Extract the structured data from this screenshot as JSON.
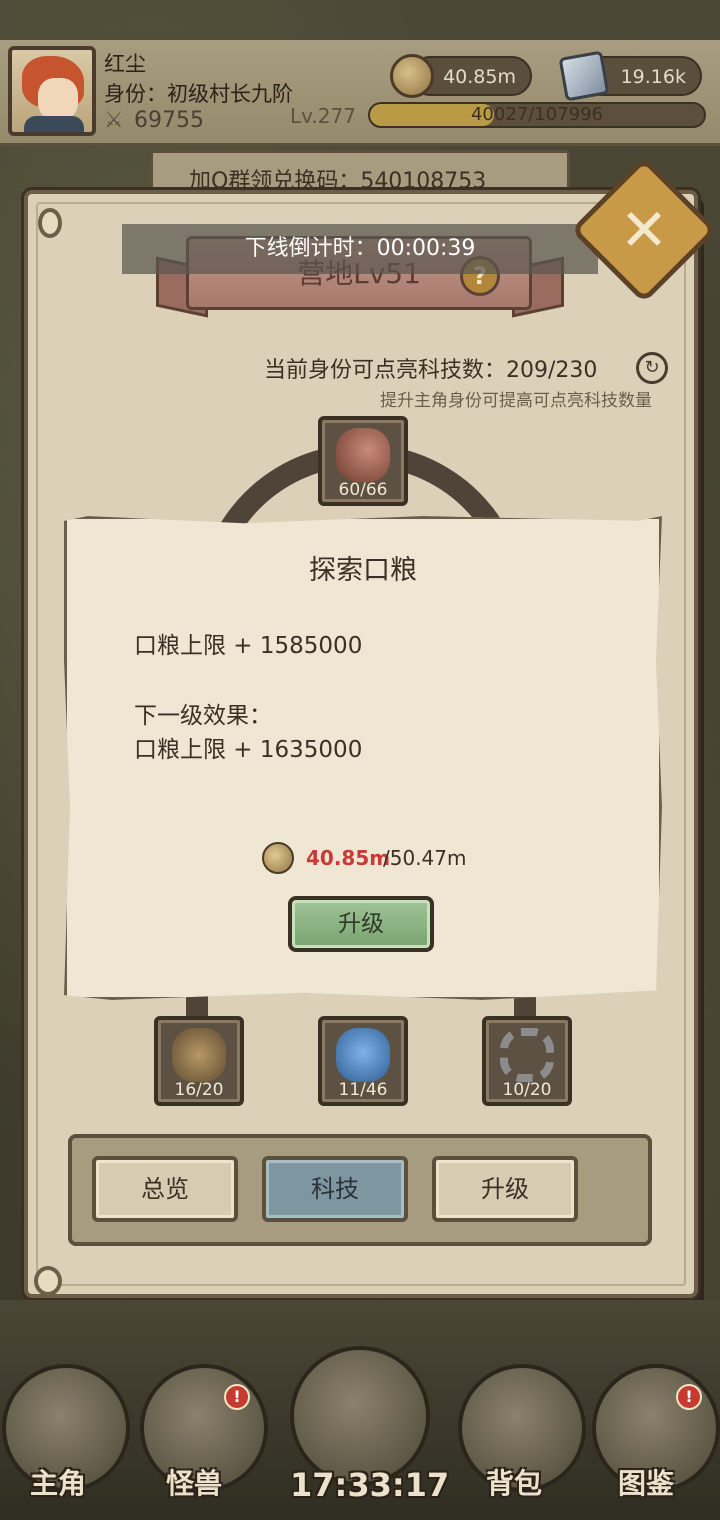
{
  "player": {
    "name": "红尘",
    "rank": "身份：初级村长九阶",
    "power": "69755",
    "level": "Lv.277",
    "xp_text": "40027/107996",
    "xp_fraction": 0.3706
  },
  "resources": {
    "coins": "40.85m",
    "gems": "19.16k"
  },
  "redeem_code": "加Q群领兑换码：540108753",
  "panel": {
    "title": "营地Lv51",
    "countdown": "下线倒计时：00:00:39",
    "tech_count": "当前身份可点亮科技数：209/230",
    "tech_tip": "提升主角身份可提高可点亮科技数量"
  },
  "tech_nodes": [
    {
      "name": "meat",
      "count": "60/66"
    },
    {
      "name": "sack",
      "count": "16/20"
    },
    {
      "name": "slime",
      "count": "11/46"
    },
    {
      "name": "gear",
      "count": "10/20"
    }
  ],
  "popup": {
    "title": "探索口粮",
    "current_effect": "口粮上限 + 1585000",
    "next_label": "下一级效果：",
    "next_effect": "口粮上限 + 1635000",
    "cost_have": "40.85m",
    "cost_need": "/50.47m",
    "upgrade_label": "升级"
  },
  "tabs": [
    {
      "label": "总览",
      "active": false
    },
    {
      "label": "科技",
      "active": true
    },
    {
      "label": "升级",
      "active": false
    }
  ],
  "nav": {
    "hero": "主角",
    "monster": "怪兽",
    "bag": "背包",
    "codex": "图鉴",
    "clock": "17:33:17"
  },
  "colors": {
    "panel_bg": "#dcd1b8",
    "note_bg": "#efe6d3",
    "cost_have_red": "#c93a36",
    "upgrade_green": "#8fb486",
    "active_tab_blue": "#7d96a0"
  }
}
